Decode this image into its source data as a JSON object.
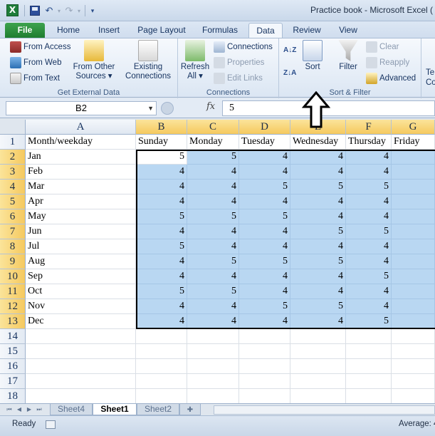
{
  "app": {
    "window_title": "Practice book  -  Microsoft Excel (",
    "logo_letter": "X"
  },
  "ribbon_tabs": [
    {
      "label": "File"
    },
    {
      "label": "Home"
    },
    {
      "label": "Insert"
    },
    {
      "label": "Page Layout"
    },
    {
      "label": "Formulas"
    },
    {
      "label": "Data"
    },
    {
      "label": "Review"
    },
    {
      "label": "View"
    }
  ],
  "ribbon": {
    "get_external_data": {
      "label": "Get External Data",
      "from_access": "From Access",
      "from_web": "From Web",
      "from_text": "From Text",
      "from_other_sources_1": "From Other",
      "from_other_sources_2": "Sources ▾",
      "existing_connections_1": "Existing",
      "existing_connections_2": "Connections"
    },
    "connections": {
      "label": "Connections",
      "refresh_all_1": "Refresh",
      "refresh_all_2": "All ▾",
      "connections": "Connections",
      "properties": "Properties",
      "edit_links": "Edit Links"
    },
    "sort_filter": {
      "label": "Sort & Filter",
      "sort_az": "A↓Z",
      "sort_za": "Z↓A",
      "sort": "Sort",
      "filter": "Filter",
      "clear": "Clear",
      "reapply": "Reapply",
      "advanced": "Advanced"
    },
    "cut_off_1": "Te",
    "cut_off_2": "Co"
  },
  "formula_bar": {
    "name_box": "B2",
    "fx": "fx",
    "value": "5"
  },
  "columns": [
    "A",
    "B",
    "C",
    "D",
    "E",
    "F",
    "G"
  ],
  "rows": [
    "1",
    "2",
    "3",
    "4",
    "5",
    "6",
    "7",
    "8",
    "9",
    "10",
    "11",
    "12",
    "13",
    "14",
    "15",
    "16",
    "17",
    "18"
  ],
  "header_row": [
    "Month/weekday",
    "Sunday",
    "Monday",
    "Tuesday",
    "Wednesday",
    "Thursday",
    "Friday"
  ],
  "table": [
    {
      "month": "Jan",
      "values": [
        "5",
        "5",
        "4",
        "4",
        "4"
      ]
    },
    {
      "month": "Feb",
      "values": [
        "4",
        "4",
        "4",
        "4",
        "4"
      ]
    },
    {
      "month": "Mar",
      "values": [
        "4",
        "4",
        "5",
        "5",
        "5"
      ]
    },
    {
      "month": "Apr",
      "values": [
        "4",
        "4",
        "4",
        "4",
        "4"
      ]
    },
    {
      "month": "May",
      "values": [
        "5",
        "5",
        "5",
        "4",
        "4"
      ]
    },
    {
      "month": "Jun",
      "values": [
        "4",
        "4",
        "4",
        "5",
        "5"
      ]
    },
    {
      "month": "Jul",
      "values": [
        "5",
        "4",
        "4",
        "4",
        "4"
      ]
    },
    {
      "month": "Aug",
      "values": [
        "4",
        "5",
        "5",
        "5",
        "4"
      ]
    },
    {
      "month": "Sep",
      "values": [
        "4",
        "4",
        "4",
        "4",
        "5"
      ]
    },
    {
      "month": "Oct",
      "values": [
        "5",
        "5",
        "4",
        "4",
        "4"
      ]
    },
    {
      "month": "Nov",
      "values": [
        "4",
        "4",
        "5",
        "5",
        "4"
      ]
    },
    {
      "month": "Dec",
      "values": [
        "4",
        "4",
        "4",
        "4",
        "5"
      ]
    }
  ],
  "sheets": [
    {
      "label": "Sheet4"
    },
    {
      "label": "Sheet1"
    },
    {
      "label": "Sheet2"
    }
  ],
  "status": {
    "ready": "Ready",
    "average": "Average: 4"
  },
  "colors": {
    "selection_fill": "#b9d7f2",
    "header_selected": "#f5c95f",
    "file_tab": "#1f7d2f"
  }
}
